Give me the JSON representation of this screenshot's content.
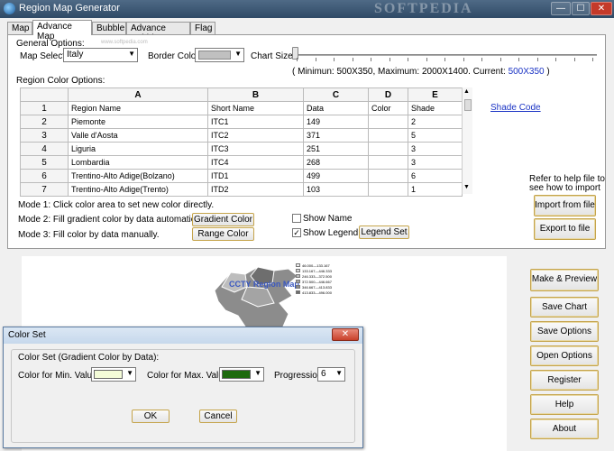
{
  "window": {
    "title": "Region Map Generator",
    "watermark": "SOFTPEDIA",
    "min": "—",
    "max": "☐",
    "close": "✕"
  },
  "tabs": [
    "Map",
    "Advance Map",
    "Bubble",
    "Advance Bubble",
    "Flag"
  ],
  "general": {
    "header": "General Options:",
    "map_select_label": "Map Select:",
    "map_select_value": "Italy",
    "border_color_label": "Border Color:",
    "border_color": "#c0c0c0",
    "chart_size_label": "Chart Size:",
    "size_text": "( Minimun: 500X350, Maximum: 2000X1400. Current: ",
    "size_current": "500X350",
    "size_close": ")",
    "watermark_small": "www.softpedia.com"
  },
  "region": {
    "header": "Region Color Options:",
    "columns": [
      "A",
      "B",
      "C",
      "D",
      "E"
    ],
    "field_row": {
      "num": "1",
      "a": "Region Name",
      "b": "Short Name",
      "c": "Data",
      "d": "Color",
      "e": "Shade"
    },
    "rows": [
      {
        "num": "2",
        "a": "Piemonte",
        "b": "ITC1",
        "c": "149",
        "d": "",
        "e": "2"
      },
      {
        "num": "3",
        "a": "Valle d'Aosta",
        "b": "ITC2",
        "c": "371",
        "d": "",
        "e": "5"
      },
      {
        "num": "4",
        "a": "Liguria",
        "b": "ITC3",
        "c": "251",
        "d": "",
        "e": "3"
      },
      {
        "num": "5",
        "a": "Lombardia",
        "b": "ITC4",
        "c": "268",
        "d": "",
        "e": "3"
      },
      {
        "num": "6",
        "a": "Trentino-Alto Adige(Bolzano)",
        "b": "ITD1",
        "c": "499",
        "d": "",
        "e": "6"
      },
      {
        "num": "7",
        "a": "Trentino-Alto Adige(Trento)",
        "b": "ITD2",
        "c": "103",
        "d": "",
        "e": "1"
      }
    ],
    "shade_code": "Shade Code",
    "help_text_1": "Refer to help file to",
    "help_text_2": "see how to import",
    "import_btn": "Import from file",
    "export_btn": "Export to file"
  },
  "modes": {
    "mode1": "Mode 1: Click color area to set new color directly.",
    "mode2": "Mode 2: Fill gradient color by data automatically.",
    "mode3": "Mode 3: Fill color by data manually.",
    "gradient_btn": "Gradient Color",
    "range_btn": "Range Color",
    "show_name": "Show Name",
    "show_legend": "Show Legend",
    "show_legend_check": "✓",
    "legend_btn": "Legend Set"
  },
  "preview": {
    "map_title": "CCTY Region Map",
    "legend": [
      "46.000—133.167",
      "133.167—446.333",
      "246.333—372.500",
      "372.500—446.667",
      "346.667—413.833",
      "413.833—496.000"
    ],
    "legend_colors": [
      "#eeeeee",
      "#d6d6d6",
      "#bdbdbd",
      "#a4a4a4",
      "#8a8a8a",
      "#6e6e6e"
    ]
  },
  "side_buttons": [
    "Make & Preview",
    "Save Chart",
    "Save Options",
    "Open Options",
    "Register",
    "Help",
    "About"
  ],
  "dialog": {
    "title": "Color Set",
    "group": "Color Set (Gradient Color by Data):",
    "min_label": "Color for Min. Value:",
    "min_color": "#f4fcd8",
    "max_label": "Color for Max. Value:",
    "max_color": "#1e6a0e",
    "progression_label": "Progression:",
    "progression_value": "6",
    "ok": "OK",
    "cancel": "Cancel",
    "close": "✕"
  }
}
